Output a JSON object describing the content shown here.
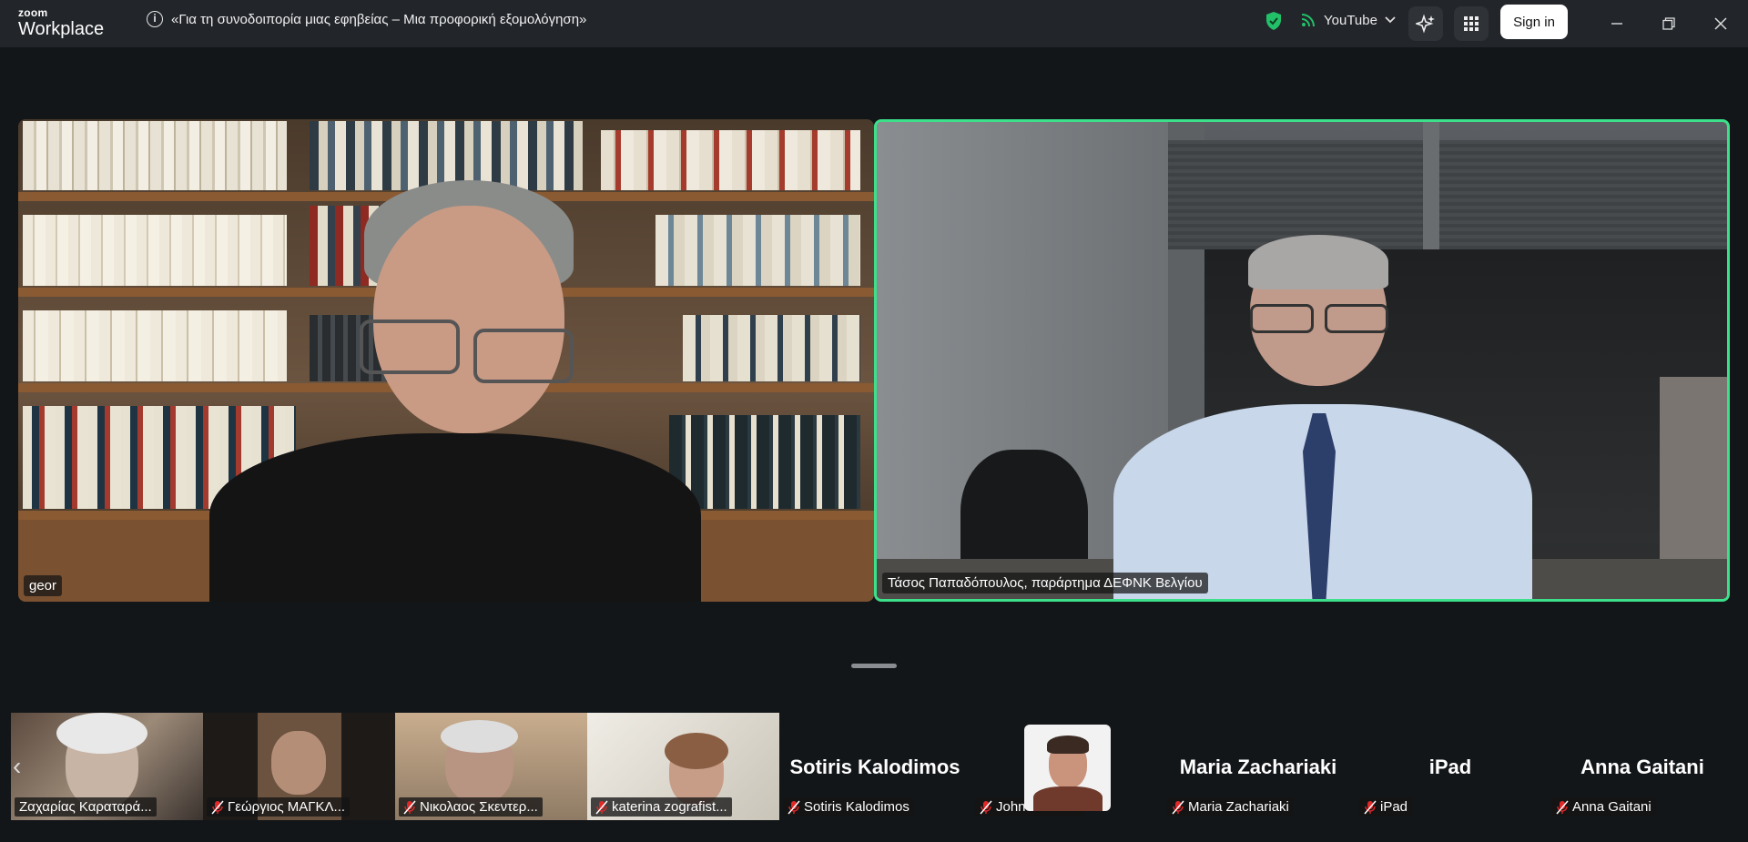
{
  "app": {
    "logo_top": "zoom",
    "logo_bottom": "Workplace"
  },
  "titlebar": {
    "info_icon": "i",
    "meeting_title": "«Για τη συνοδοιπορία μιας εφηβείας – Μια προφορική εξομολόγηση»",
    "stream_label": "YouTube",
    "sign_in": "Sign in"
  },
  "colors": {
    "active_speaker_border": "#3ce08a",
    "titlebar_bg": "#22252a",
    "background": "#131619",
    "security_green": "#23c06a"
  },
  "main_tiles": [
    {
      "name": "geor"
    },
    {
      "name": "Τάσος Παπαδόπουλος, παράρτημα ΔΕΦΝΚ Βελγίου"
    }
  ],
  "gallery": [
    {
      "name": "Ζαχαρίας Καραταρά...",
      "muted": false
    },
    {
      "name": "Γεώργιος ΜΑΓΚΛ...",
      "muted": true
    },
    {
      "name": "Νικολαος Σκεντερ...",
      "muted": true
    },
    {
      "name": "katerina zografist...",
      "muted": true
    },
    {
      "name": "Sotiris Kalodimos",
      "display": "Sotiris Kalodimos",
      "muted": true
    },
    {
      "name": "John Alexakis",
      "muted": true
    },
    {
      "name": "Maria Zachariaki",
      "display": "Maria Zachariaki",
      "muted": true
    },
    {
      "name": "iPad",
      "display": "iPad",
      "muted": true
    },
    {
      "name": "Anna Gaitani",
      "display": "Anna Gaitani",
      "muted": true
    }
  ],
  "gallery_prev": "‹"
}
